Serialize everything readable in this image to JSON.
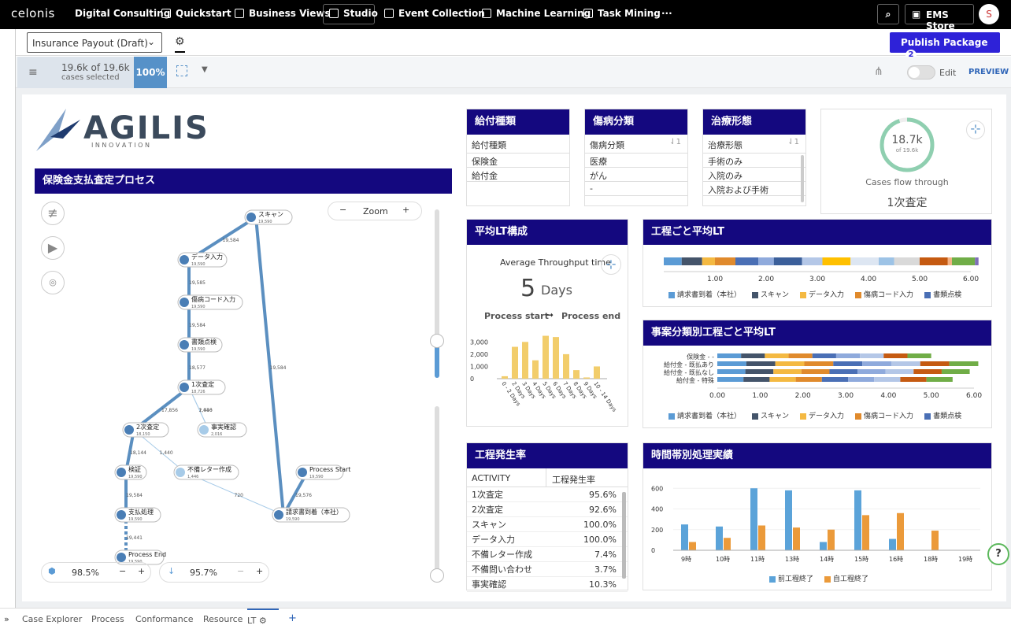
{
  "topnav": {
    "brand": "celonis",
    "items": [
      "Digital Consulting",
      "Quickstart",
      "Business Views",
      "Studio",
      "Event Collection",
      "Machine Learning",
      "Task Mining"
    ],
    "more": "···",
    "store": "EMS Store",
    "avatar": "S"
  },
  "bar2": {
    "package_name": "Insurance Payout (Draft)",
    "publish_label": "Publish Package",
    "publish_count": "2"
  },
  "bar3": {
    "cases": "19.6k of 19.6k",
    "cases_sub": "cases selected",
    "percent": "100%",
    "edit": "Edit",
    "preview": "PREVIEW"
  },
  "logo": {
    "name": "AGILIS",
    "sub": "I N N O V A T I O N"
  },
  "process": {
    "title": "保険金支払査定プロセス",
    "zoom_label": "Zoom",
    "nodes": [
      {
        "label": "スキャン",
        "count": "19,590"
      },
      {
        "label": "データ入力",
        "count": "19,590"
      },
      {
        "label": "傷病コード入力",
        "count": "19,590"
      },
      {
        "label": "書類点検",
        "count": "19,590"
      },
      {
        "label": "1次査定",
        "count": "18,726"
      },
      {
        "label": "2次査定",
        "count": "18,150"
      },
      {
        "label": "事実確認",
        "count": "2,016"
      },
      {
        "label": "検証",
        "count": "19,590"
      },
      {
        "label": "不備レター作成",
        "count": "1,446"
      },
      {
        "label": "支払処理",
        "count": "19,590"
      },
      {
        "label": "Process Start",
        "count": "19,590"
      },
      {
        "label": "請求書到着（本社）",
        "count": "19,590"
      },
      {
        "label": "Process End",
        "count": "19,590"
      }
    ],
    "edges": [
      "19,584",
      "19,585",
      "19,584",
      "18,577",
      "17,856",
      "2,016",
      "1,440",
      "18,144",
      "1,440",
      "720",
      "19,584",
      "19,441",
      "19,576",
      "19,584"
    ],
    "slider_left": "98.5%",
    "slider_right": "95.7%"
  },
  "filters": [
    {
      "title": "給付種類",
      "header": "給付種類",
      "items": [
        "保険金",
        "給付金"
      ]
    },
    {
      "title": "傷病分類",
      "header": "傷病分類",
      "sort": "1",
      "items": [
        "医療",
        "がん",
        "-"
      ]
    },
    {
      "title": "治療形態",
      "header": "治療形態",
      "sort": "1",
      "items": [
        "手術のみ",
        "入院のみ",
        "入院および手術"
      ]
    }
  ],
  "flow": {
    "value": "18.7k",
    "of": "of 19.6k",
    "caption": "Cases flow through",
    "activity": "1次査定"
  },
  "avg_lt": {
    "title": "平均LT構成",
    "label": "Average Throughput time",
    "value": "5",
    "unit": "Days",
    "start": "Process start",
    "arrow": "➞",
    "end": "Process end",
    "chart_data": {
      "type": "bar",
      "categories": [
        "0 - 2 Days",
        "2 Days",
        "3 Days",
        "4 Days",
        "5 Days",
        "6 Days",
        "7 Days",
        "8 Days",
        "9 Days",
        "10 - 14 Days"
      ],
      "values": [
        200,
        2600,
        3000,
        1500,
        3500,
        3400,
        2000,
        700,
        100,
        1000
      ],
      "yticks": [
        "3,000",
        "2,000",
        "1,000",
        "0"
      ],
      "ylim": [
        0,
        3600
      ],
      "color": "#f2cd6b"
    }
  },
  "step_lt": {
    "title": "工程ごと平均LT",
    "xticks": [
      "1.00",
      "2.00",
      "3.00",
      "4.00",
      "5.00",
      "6.00"
    ],
    "legend": [
      "請求書到着（本社）",
      "スキャン",
      "データ入力",
      "傷病コード入力",
      "書類点検"
    ],
    "chart_data": {
      "type": "bar",
      "segments": [
        0.35,
        0.4,
        0.25,
        0.4,
        0.45,
        0.3,
        0.55,
        0.4,
        0.55,
        0.55,
        0.3,
        0.5,
        0.55,
        0.08,
        0.45,
        0.07
      ],
      "colors": [
        "#5b9bd5",
        "#44546a",
        "#f4b942",
        "#e08a2c",
        "#4a6fb5",
        "#8faadc",
        "#3b5f9a",
        "#b4c7e7",
        "#ffc000",
        "#dde6f2",
        "#9dc3e6",
        "#d9d9d9",
        "#c55a11",
        "#f4b183",
        "#70ad47",
        "#7f6fb8"
      ],
      "xlim": [
        0,
        6
      ]
    }
  },
  "case_lt": {
    "title": "事案分類別工程ごと平均LT",
    "rows": [
      "保険金 - -",
      "給付金 - 既払あり",
      "給付金 - 既払なし",
      "給付金 - 特殊"
    ],
    "xticks": [
      "0.00",
      "1.00",
      "2.00",
      "3.00",
      "4.00",
      "5.00",
      "6.00"
    ],
    "legend": [
      "請求書到着（本社）",
      "スキャン",
      "データ入力",
      "傷病コード入力",
      "書類点検"
    ],
    "chart_data": {
      "type": "bar",
      "totals": [
        5.0,
        6.1,
        5.9,
        5.5
      ],
      "xlim": [
        0,
        6
      ]
    }
  },
  "occurrence": {
    "title": "工程発生率",
    "headers": [
      "ACTIVITY",
      "工程発生率"
    ],
    "rows": [
      [
        "1次査定",
        "95.6%"
      ],
      [
        "2次査定",
        "92.6%"
      ],
      [
        "スキャン",
        "100.0%"
      ],
      [
        "データ入力",
        "100.0%"
      ],
      [
        "不備レター作成",
        "7.4%"
      ],
      [
        "不備問い合わせ",
        "3.7%"
      ],
      [
        "事実確認",
        "10.3%"
      ]
    ]
  },
  "hourly": {
    "title": "時間帯別処理実績",
    "legend": [
      "前工程終了",
      "自工程終了"
    ],
    "chart_data": {
      "type": "bar",
      "categories": [
        "9時",
        "10時",
        "11時",
        "13時",
        "14時",
        "15時",
        "16時",
        "18時",
        "19時"
      ],
      "series": [
        {
          "name": "前工程終了",
          "values": [
            250,
            230,
            600,
            580,
            80,
            580,
            110,
            0,
            0
          ],
          "color": "#5ba3d9"
        },
        {
          "name": "自工程終了",
          "values": [
            80,
            120,
            240,
            220,
            200,
            340,
            360,
            190,
            0
          ],
          "color": "#eb9a3a"
        }
      ],
      "yticks": [
        "600",
        "400",
        "200",
        "0"
      ],
      "ylim": [
        0,
        640
      ]
    }
  },
  "bottom_tabs": [
    "Case Explorer",
    "Process",
    "Conformance",
    "Resource",
    "LT"
  ],
  "bottom_plus": "+",
  "bottom_expand": "»"
}
